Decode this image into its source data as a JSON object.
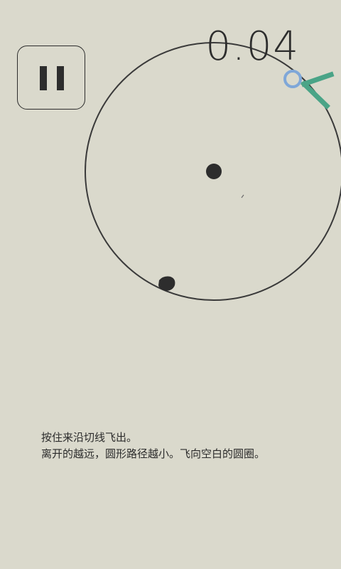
{
  "score": "0.04",
  "pause": {
    "icon": "pause-icon"
  },
  "instructions": {
    "line1": "按住来沿切线飞出。",
    "line2": "离开的越远，圆形路径越小。飞向空白的圆圈。"
  },
  "colors": {
    "background": "#dad9cc",
    "ink": "#2d2d2d",
    "target": "#7fa7d8",
    "arrow": "#4aa487"
  }
}
